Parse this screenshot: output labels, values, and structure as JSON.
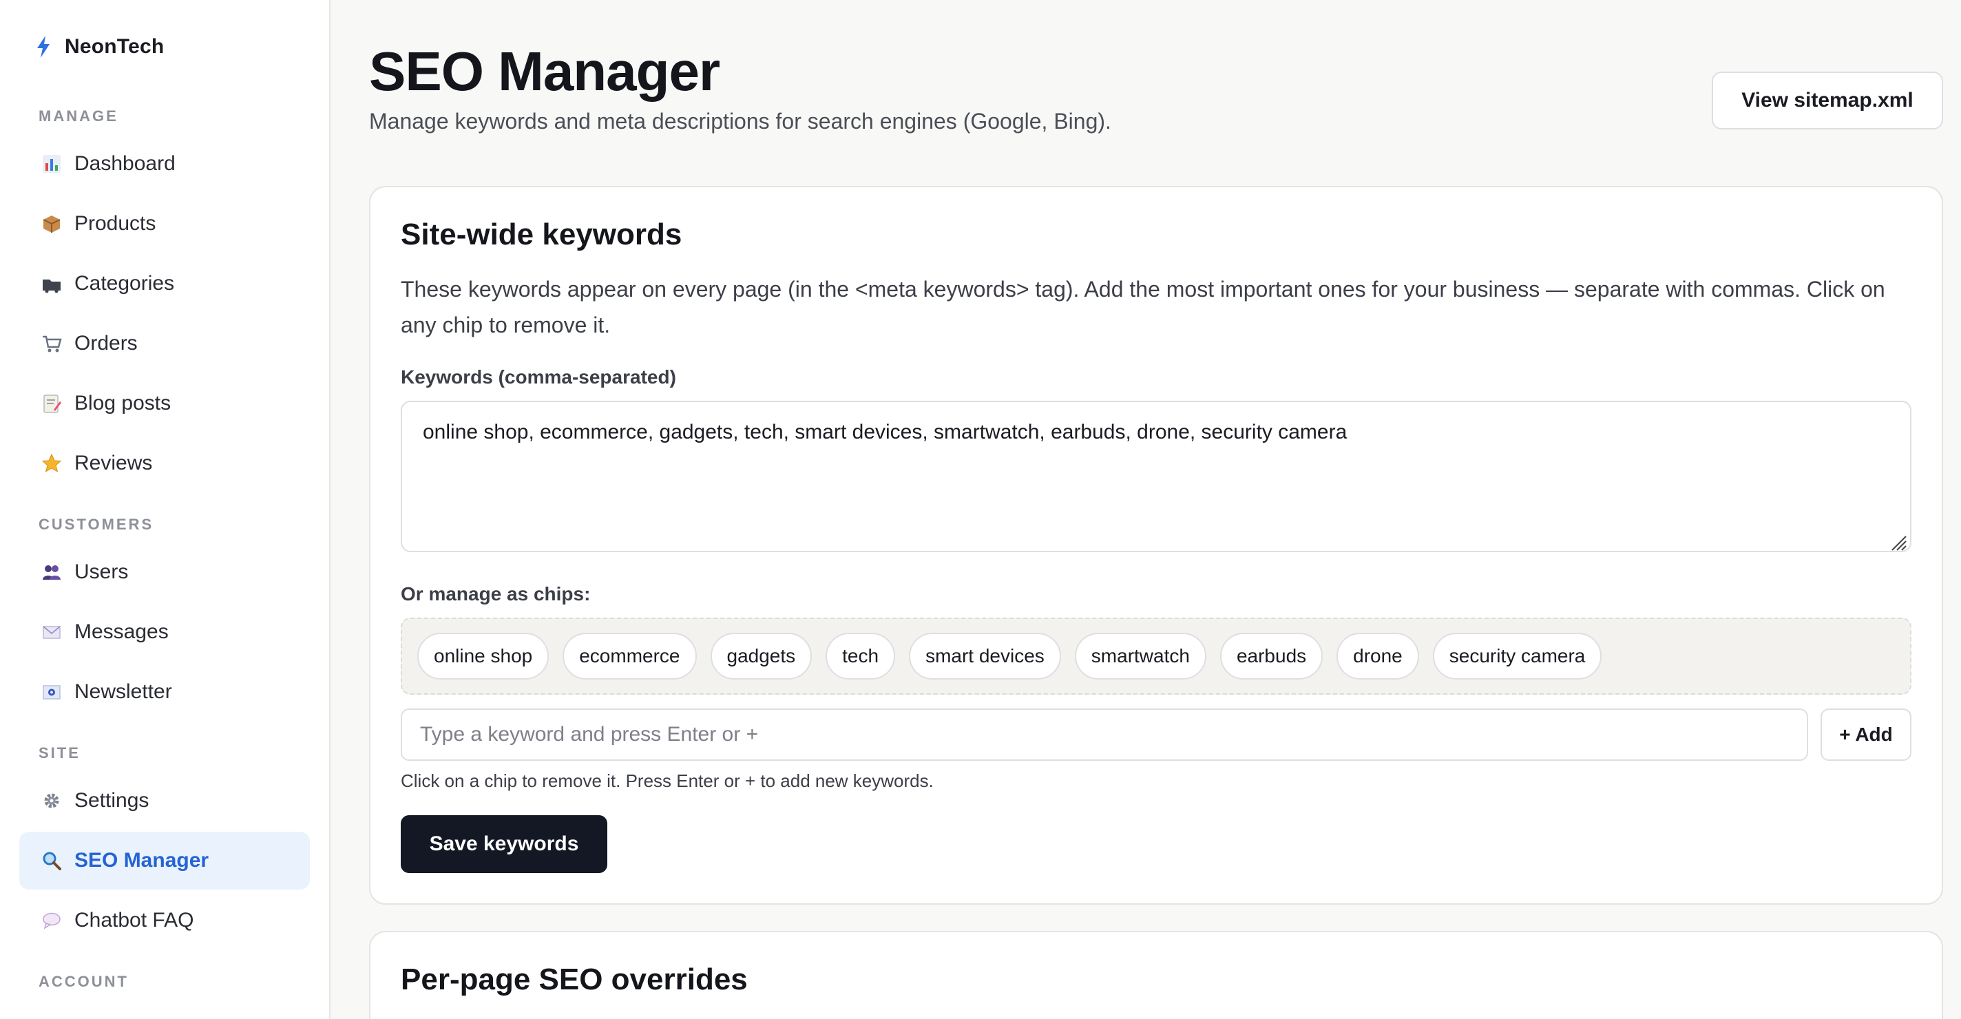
{
  "brand": {
    "name": "NeonTech"
  },
  "sidebar": {
    "sections": [
      {
        "label": "MANAGE",
        "items": [
          {
            "label": "Dashboard",
            "icon": "bar-chart-icon"
          },
          {
            "label": "Products",
            "icon": "package-icon"
          },
          {
            "label": "Categories",
            "icon": "folder-icon"
          },
          {
            "label": "Orders",
            "icon": "cart-icon"
          },
          {
            "label": "Blog posts",
            "icon": "memo-icon"
          },
          {
            "label": "Reviews",
            "icon": "star-icon"
          }
        ]
      },
      {
        "label": "CUSTOMERS",
        "items": [
          {
            "label": "Users",
            "icon": "users-icon"
          },
          {
            "label": "Messages",
            "icon": "envelope-icon"
          },
          {
            "label": "Newsletter",
            "icon": "newsletter-icon"
          }
        ]
      },
      {
        "label": "SITE",
        "items": [
          {
            "label": "Settings",
            "icon": "gear-icon"
          },
          {
            "label": "SEO Manager",
            "icon": "magnifier-icon",
            "active": true
          },
          {
            "label": "Chatbot FAQ",
            "icon": "speech-bubble-icon"
          }
        ]
      },
      {
        "label": "ACCOUNT",
        "items": []
      }
    ]
  },
  "header": {
    "title": "SEO Manager",
    "subtitle": "Manage keywords and meta descriptions for search engines (Google, Bing).",
    "sitemap_button": "View sitemap.xml"
  },
  "keywords_card": {
    "title": "Site-wide keywords",
    "description": "These keywords appear on every page (in the <meta keywords> tag). Add the most important ones for your business — separate with commas. Click on any chip to remove it.",
    "field_label": "Keywords (comma-separated)",
    "textarea_value": "online shop, ecommerce, gadgets, tech, smart devices, smartwatch, earbuds, drone, security camera",
    "chips_label": "Or manage as chips:",
    "chips": [
      "online shop",
      "ecommerce",
      "gadgets",
      "tech",
      "smart devices",
      "smartwatch",
      "earbuds",
      "drone",
      "security camera"
    ],
    "add_placeholder": "Type a keyword and press Enter or +",
    "add_button": "+ Add",
    "hint": "Click on a chip to remove it. Press Enter or + to add new keywords.",
    "save_button": "Save keywords"
  },
  "overrides_card": {
    "title": "Per-page SEO overrides"
  },
  "colors": {
    "accent": "#2563d6",
    "active_bg": "#eaf3fd",
    "primary_button": "#141824",
    "page_bg": "#f8f8f6"
  }
}
